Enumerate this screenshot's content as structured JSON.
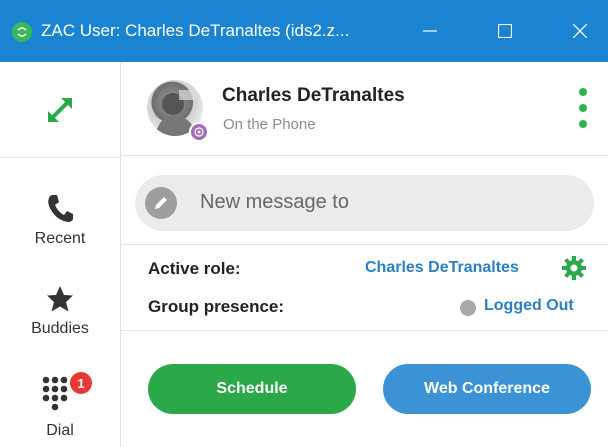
{
  "window": {
    "title": "ZAC User: Charles DeTranaltes (ids2.z...",
    "logo_text": "ZAC",
    "accent_color": "#1a84d2",
    "minimize_icon": "minimize-icon",
    "maximize_icon": "maximize-icon",
    "close_icon": "close-icon"
  },
  "sidebar": {
    "expand_icon": "expand-arrows-icon",
    "items": [
      {
        "label": "Recent",
        "icon": "phone-icon"
      },
      {
        "label": "Buddies",
        "icon": "star-icon"
      },
      {
        "label": "Dial",
        "icon": "dialpad-icon",
        "badge": "1"
      }
    ]
  },
  "contact": {
    "name": "Charles DeTranaltes",
    "status": "On the Phone",
    "presence_color": "#a26bb6",
    "menu_icon": "kebab-menu-icon"
  },
  "message": {
    "placeholder": "New message to",
    "icon": "pencil-icon"
  },
  "role": {
    "active_role_label": "Active role:",
    "active_role_value": "Charles DeTranaltes",
    "settings_icon": "gear-icon",
    "group_presence_label": "Group presence:",
    "group_presence_value": "Logged Out"
  },
  "actions": {
    "schedule_label": "Schedule",
    "web_conference_label": "Web Conference"
  },
  "colors": {
    "green": "#2aa84a",
    "blue": "#3b93d6",
    "link_blue": "#2a7fc6",
    "badge_red": "#e53935"
  }
}
